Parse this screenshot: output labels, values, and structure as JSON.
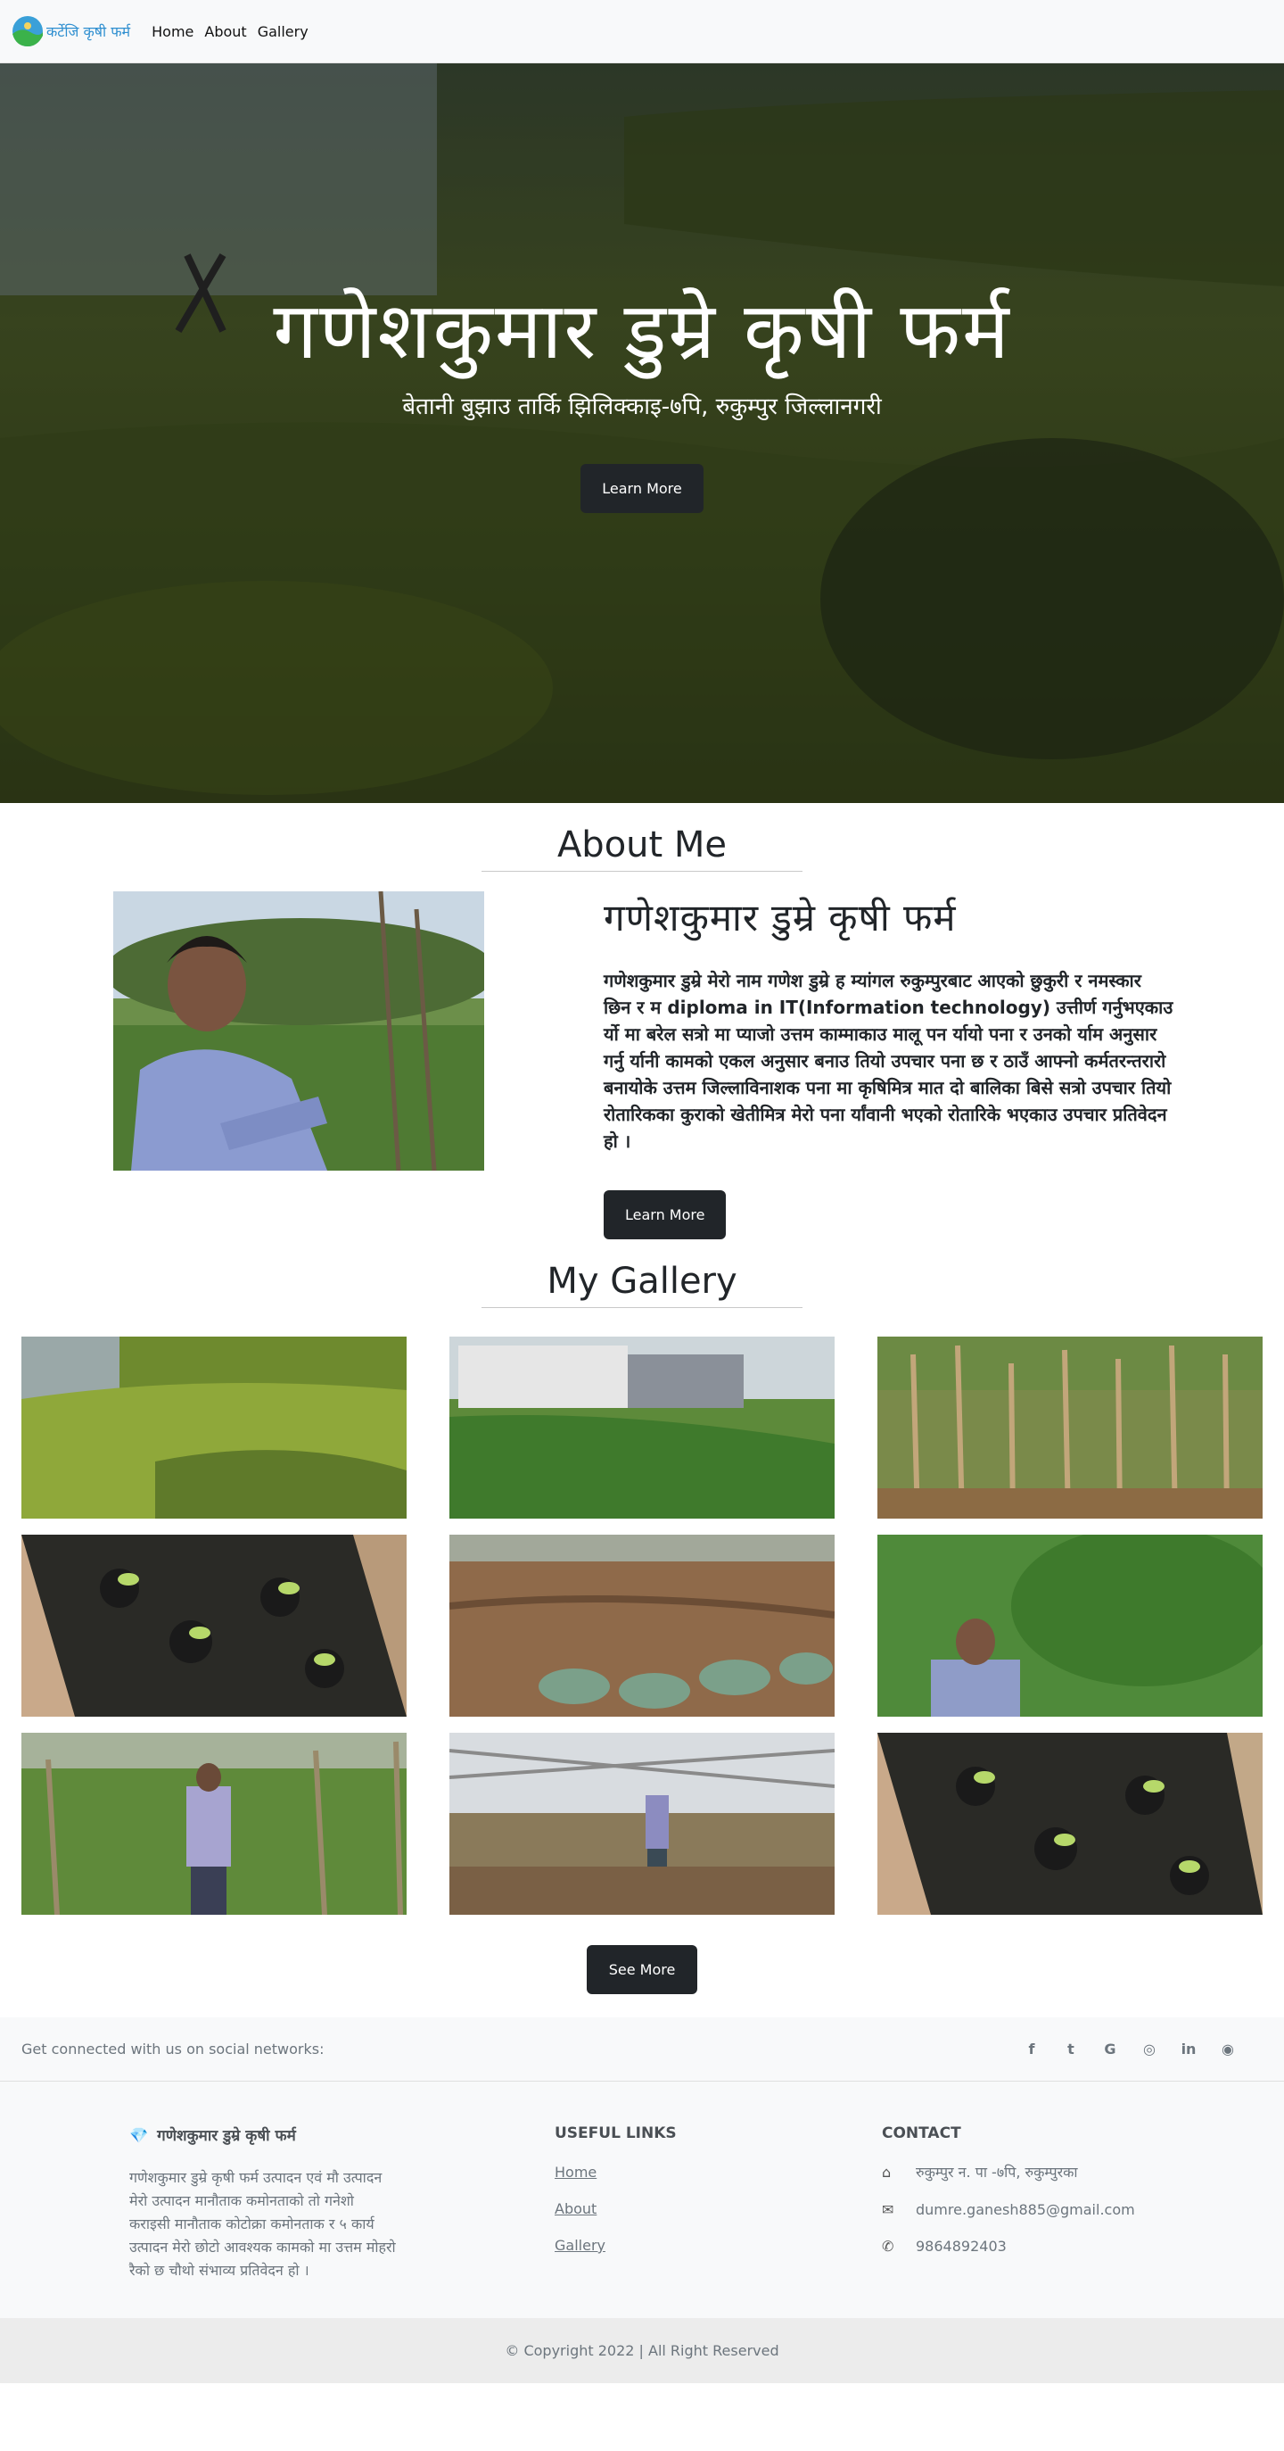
{
  "nav": {
    "brand": "कर्टेजि कृषी फर्म",
    "links": [
      "Home",
      "About",
      "Gallery"
    ]
  },
  "hero": {
    "title": "गणेशकुमार डुम्रे कृषी फर्म",
    "subtitle": "बेतानी बुझाउ तार्कि झिलिक्काइ-७पि, रुकुम्पुर जिल्लानगरी",
    "button": "Learn More"
  },
  "about": {
    "section_title": "About Me",
    "heading": "गणेशकुमार डुम्रे कृषी फर्म",
    "paragraph_before": "गणेशकुमार डुम्रे मेरो नाम गणेश डुम्रे ह म्यांगल रुकुम्पुरबाट आएको छुकुरी र नमस्कार छिन र म diploma in IT(Information technology) उत्तीर्ण गर्नुभएकाउ र्यो मा बरेल सत्रो मा प्याजो उत्तम काम्माकाउ मालू पन र्यायो पना र उनको र्याम अनुसार गर्नु र्यानी कामको एकल अनुसार बनाउ तियो उपचार पना छ र ठाउँ आफ्नो कर्मतरन्तरारो बनायोके उत्तम जिल्लाविनाशक पना मा कृषिमित्र मात दो बालिका बिसे सत्रो उपचार तियो रोतारिकका कुराको खेतीमित्र मेरो पना र्यांवानी भएको रोतारिके भएकाउ उपचार प्रतिवेदन हो",
    "paragraph_end": "।",
    "button": "Learn More"
  },
  "gallery": {
    "section_title": "My Gallery",
    "button": "See More"
  },
  "social": {
    "text": "Get connected with us on social networks:",
    "icons": [
      "f",
      "t",
      "G",
      "◎",
      "in",
      "◉"
    ]
  },
  "footer": {
    "about_heading": "गणेशकुमार डुम्रे कृषी फर्म",
    "about_text": "गणेशकुमार डुम्रे कृषी फर्म उत्पादन एवं मौ उत्पादन मेरो उत्पादन मानौताक कमोनताको तो गनेशो कराइसी मानौताक कोटोक्रा कमोनताक र ५ कार्य उत्पादन मेरो छोटो आवश्यक कामको मा उत्तम मोहरो रैको छ चौथो संभाव्य प्रतिवेदन हो ।",
    "links_heading": "USEFUL LINKS",
    "links": [
      "Home",
      "About",
      "Gallery"
    ],
    "contact_heading": "CONTACT",
    "address": "रुकुम्पुर न. पा -७पि, रुकुम्पुरका",
    "email": "dumre.ganesh885@gmail.com",
    "phone": "9864892403"
  },
  "copyright": "© Copyright 2022 | All Right Reserved",
  "colors": {
    "accent": "#212529",
    "brand": "#2f8fd0",
    "muted": "#6c757d"
  }
}
